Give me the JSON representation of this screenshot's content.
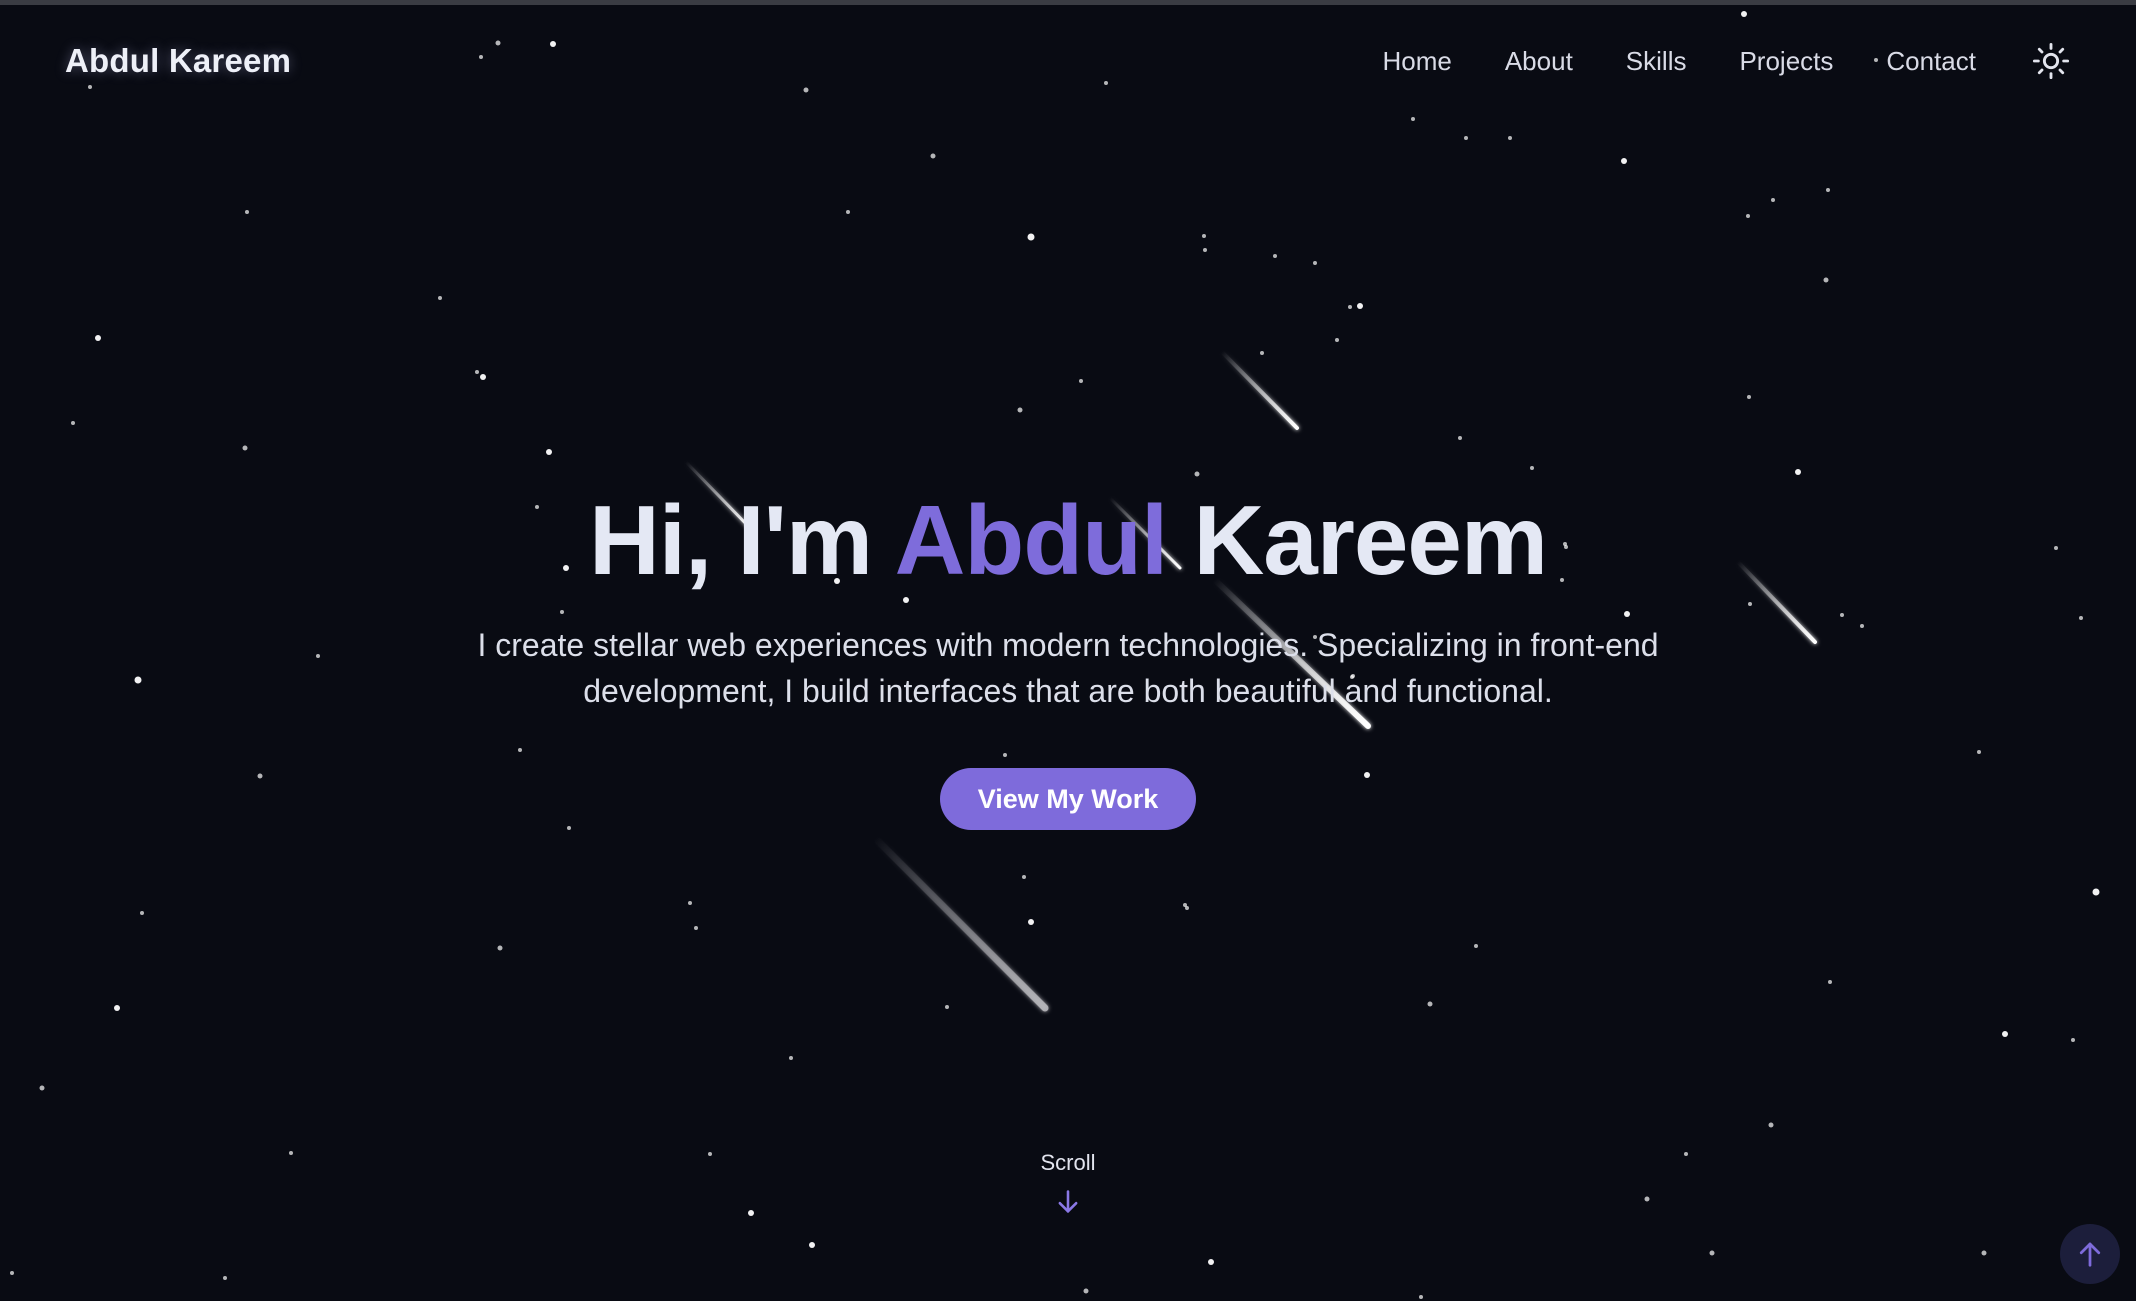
{
  "header": {
    "logo": "Abdul Kareem",
    "nav": [
      {
        "label": "Home"
      },
      {
        "label": "About"
      },
      {
        "label": "Skills"
      },
      {
        "label": "Projects"
      },
      {
        "label": "Contact"
      }
    ],
    "theme_toggle_icon": "sun-icon"
  },
  "hero": {
    "title_prefix": "Hi, I'm ",
    "title_accent": "Abdul",
    "title_suffix": " Kareem",
    "description": "I create stellar web experiences with modern technologies. Specializing in front-end development, I build interfaces that are both beautiful and functional.",
    "cta_label": "View My Work"
  },
  "scroll": {
    "label": "Scroll",
    "icon": "arrow-down-icon"
  },
  "back_to_top": {
    "icon": "arrow-up-icon"
  },
  "colors": {
    "background": "#090b13",
    "accent": "#7e6bdb",
    "text": "#e4e8f4",
    "back_to_top_bg": "#1c1e3b"
  }
}
